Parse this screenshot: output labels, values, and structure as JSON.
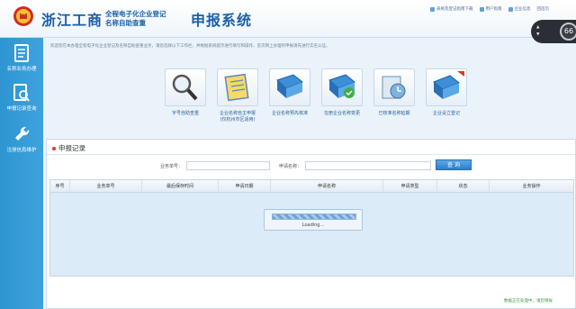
{
  "header": {
    "title_main": "浙江工商",
    "title_sub_line1": "全程电子化企业登记",
    "title_sub_line2": "名称自助查重",
    "title_system": "申报系统",
    "links": [
      {
        "label": "表格及登记指南下载",
        "icon": "download-icon"
      },
      {
        "label": "用户指南",
        "icon": "user-guide-icon"
      },
      {
        "label": "企业信息",
        "icon": "info-icon"
      },
      {
        "label": "回首页",
        "icon": "home-icon"
      }
    ]
  },
  "overlay": {
    "number": "66"
  },
  "sidebar": {
    "items": [
      {
        "label": "名称业务办理",
        "icon": "document-list-icon"
      },
      {
        "label": "申报记录查询",
        "icon": "record-search-icon"
      },
      {
        "label": "注册信息维护",
        "icon": "wrench-icon"
      }
    ]
  },
  "notice": "欢迎您在本办理全程电子化企业登记及名称自助查重业务，请您选择以下工作栏，并根据系统提示进行填写和操作，首次网上办理的申报请先进行实名认证。",
  "tiles": [
    {
      "label": "字号自助查重",
      "label2": "",
      "icon": "magnifier-icon"
    },
    {
      "label": "企业名称自主申报",
      "label2": "(仅杭州市区适用)",
      "icon": "notebook-icon"
    },
    {
      "label": "企业名称预先核准",
      "label2": "",
      "icon": "book-icon"
    },
    {
      "label": "在册企业名称变更",
      "label2": "",
      "icon": "book-change-icon"
    },
    {
      "label": "已核准名称延期",
      "label2": "",
      "icon": "extension-icon"
    },
    {
      "label": "企业设立登记",
      "label2": "",
      "icon": "registration-icon"
    }
  ],
  "records": {
    "title": "申报记录",
    "label_business_no": "业务单号：",
    "label_apply_name": "申请名称：",
    "input_business_no": "",
    "input_apply_name": "",
    "query_button": "查 询",
    "columns": [
      "序号",
      "业务单号",
      "最后保存时间",
      "申请日期",
      "申请名称",
      "申请类型",
      "状态",
      "业务操作"
    ],
    "rows": [],
    "loading_text": "Loading...",
    "status_text": "数据正在处理中，请您稍候"
  },
  "colors": {
    "brand": "#1d5fa8",
    "sidebar": "#3fa3dc",
    "accent_red": "#d23c2c"
  }
}
